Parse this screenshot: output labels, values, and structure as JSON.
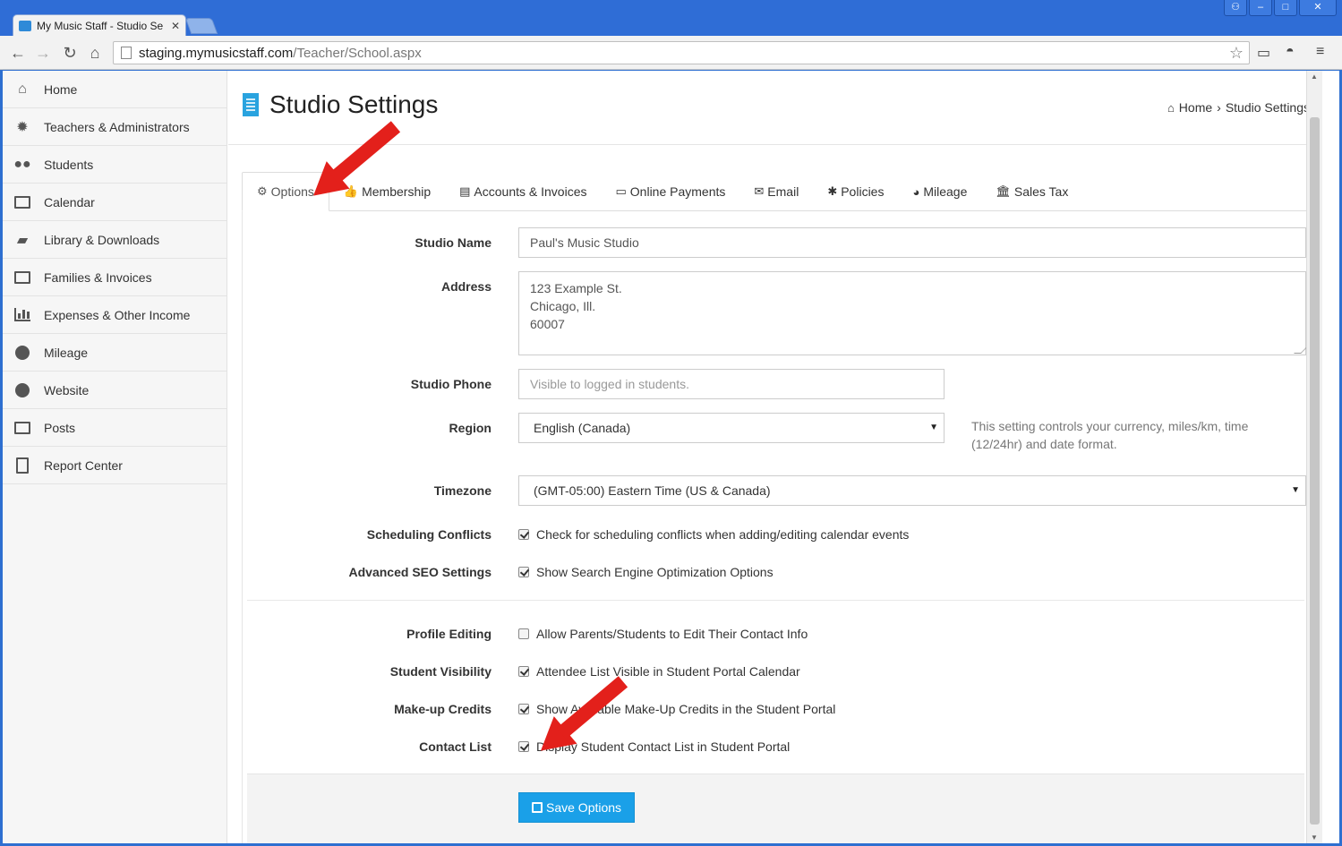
{
  "browser": {
    "tab_title": "My Music Staff - Studio Se",
    "tab_close": "✕",
    "url_host": "staging.mymusicstaff.com",
    "url_path": "/Teacher/School.aspx"
  },
  "sidebar": {
    "items": [
      {
        "label": "Home",
        "icon": "home-icon"
      },
      {
        "label": "Teachers & Administrators",
        "icon": "gear-icon"
      },
      {
        "label": "Students",
        "icon": "users-icon"
      },
      {
        "label": "Calendar",
        "icon": "calendar-icon"
      },
      {
        "label": "Library & Downloads",
        "icon": "book-icon"
      },
      {
        "label": "Families & Invoices",
        "icon": "money-icon"
      },
      {
        "label": "Expenses & Other Income",
        "icon": "bar-chart-icon"
      },
      {
        "label": "Mileage",
        "icon": "dashboard-icon"
      },
      {
        "label": "Website",
        "icon": "globe-icon"
      },
      {
        "label": "Posts",
        "icon": "newspaper-icon"
      },
      {
        "label": "Report Center",
        "icon": "document-icon"
      }
    ]
  },
  "header": {
    "title": "Studio Settings",
    "breadcrumb_home": "Home",
    "breadcrumb_sep": "›",
    "breadcrumb_current": "Studio Settings"
  },
  "tabs": [
    {
      "label": "Options",
      "icon": "gear-icon"
    },
    {
      "label": "Membership",
      "icon": "thumbs-up-icon"
    },
    {
      "label": "Accounts & Invoices",
      "icon": "file-icon"
    },
    {
      "label": "Online Payments",
      "icon": "credit-card-icon"
    },
    {
      "label": "Email",
      "icon": "envelope-icon"
    },
    {
      "label": "Policies",
      "icon": "asterisk-icon"
    },
    {
      "label": "Mileage",
      "icon": "dashboard-icon"
    },
    {
      "label": "Sales Tax",
      "icon": "bank-icon"
    }
  ],
  "form": {
    "studio_name_label": "Studio Name",
    "studio_name_value": "Paul's Music Studio",
    "address_label": "Address",
    "address_lines": [
      "123 Example St.",
      "Chicago, Ill.",
      "60007"
    ],
    "phone_label": "Studio Phone",
    "phone_placeholder": "Visible to logged in students.",
    "region_label": "Region",
    "region_value": "English (Canada)",
    "region_help": "This setting controls your currency, miles/km, time (12/24hr) and date format.",
    "timezone_label": "Timezone",
    "timezone_value": "(GMT-05:00) Eastern Time (US & Canada)",
    "scheduling_label": "Scheduling Conflicts",
    "scheduling_text": "Check for scheduling conflicts when adding/editing calendar events",
    "scheduling_checked": true,
    "seo_label": "Advanced SEO Settings",
    "seo_text": "Show Search Engine Optimization Options",
    "seo_checked": true,
    "profile_label": "Profile Editing",
    "profile_text": "Allow Parents/Students to Edit Their Contact Info",
    "profile_checked": false,
    "visibility_label": "Student Visibility",
    "visibility_text": "Attendee List Visible in Student Portal Calendar",
    "visibility_checked": true,
    "makeup_label": "Make-up Credits",
    "makeup_text": "Show Available Make-Up Credits in the Student Portal",
    "makeup_checked": true,
    "contact_label": "Contact List",
    "contact_text": "Display Student Contact List in Student Portal",
    "contact_checked": true,
    "save_label": "Save Options"
  },
  "colors": {
    "accent": "#1aa0e8",
    "annotation_arrow": "#e3201b"
  }
}
